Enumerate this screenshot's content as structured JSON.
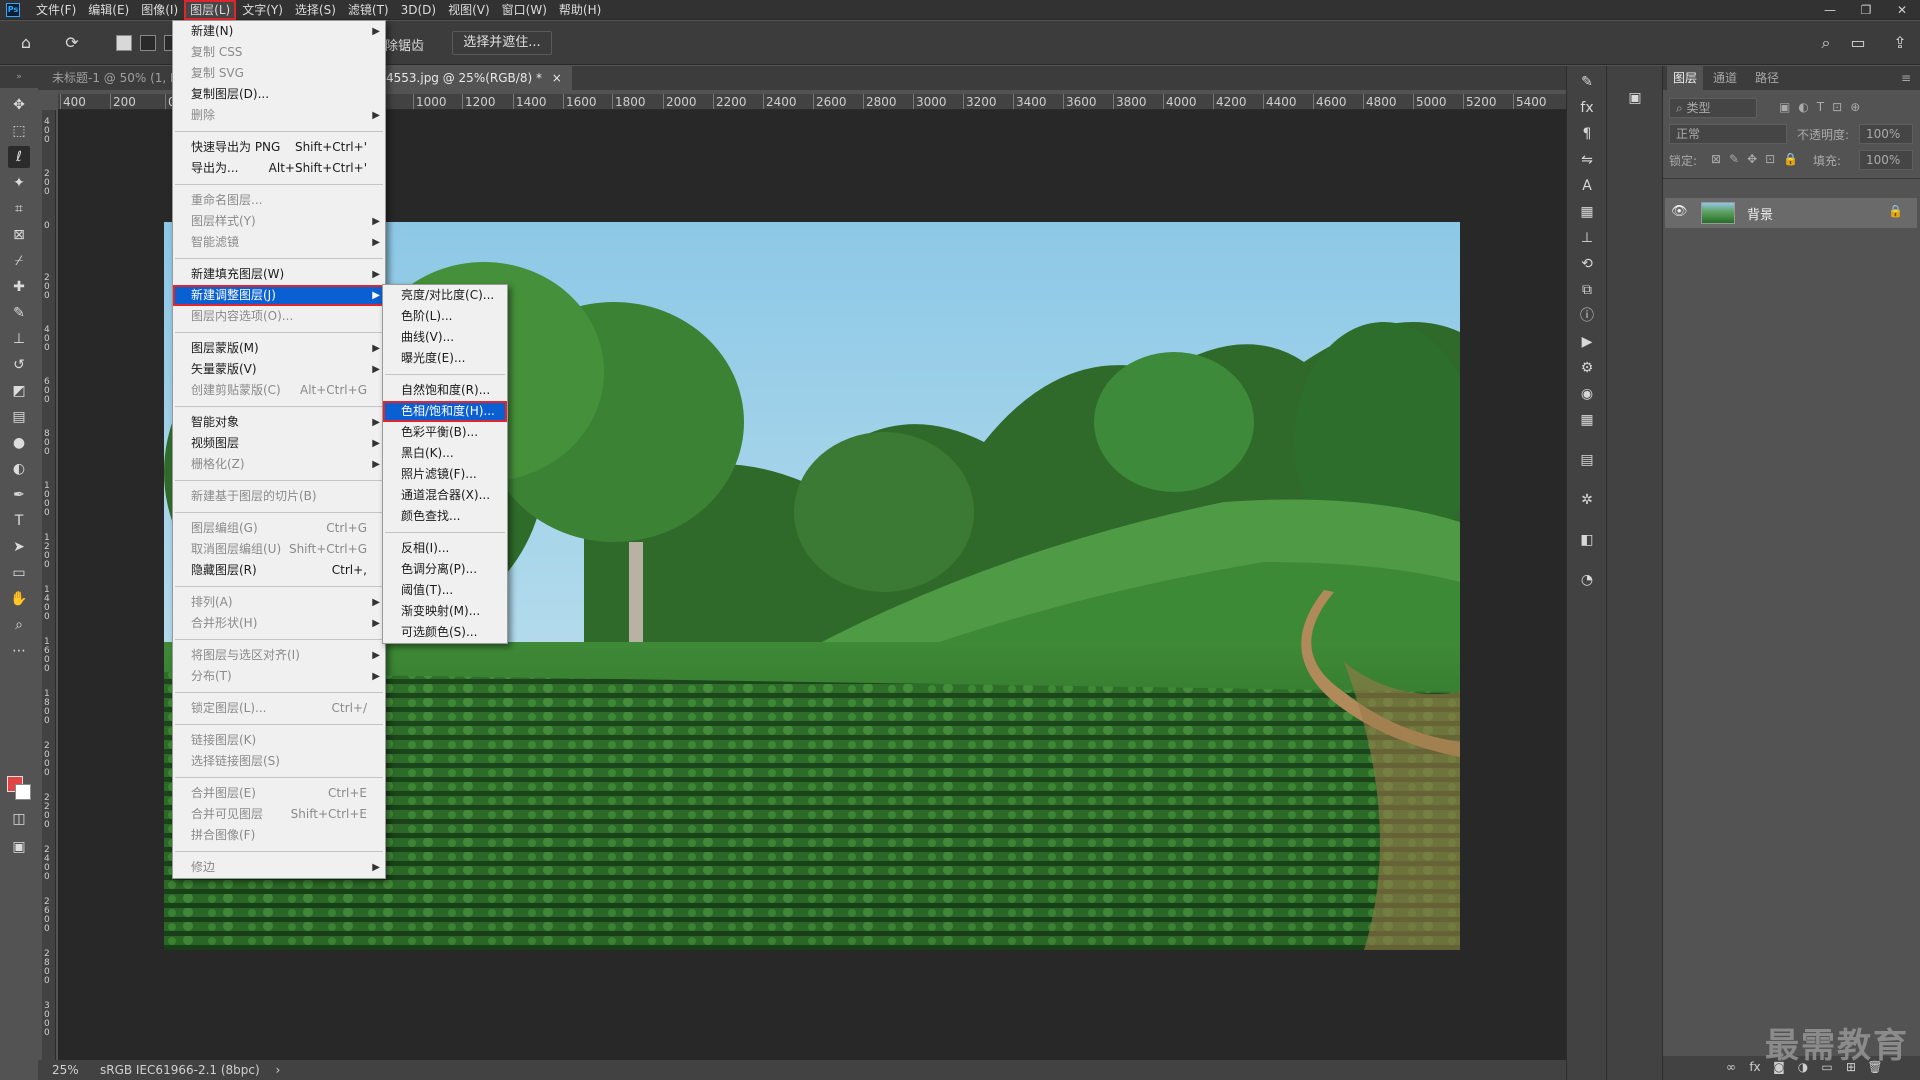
{
  "menubar": {
    "logo": "Ps",
    "items": [
      "文件(F)",
      "编辑(E)",
      "图像(I)",
      "图层(L)",
      "文字(Y)",
      "选择(S)",
      "滤镜(T)",
      "3D(D)",
      "视图(V)",
      "窗口(W)",
      "帮助(H)"
    ],
    "active_index": 3,
    "window_controls": [
      "—",
      "❐",
      "✕"
    ]
  },
  "options": {
    "antialias": "除锯齿",
    "select_mask": "选择并遮住..."
  },
  "tabs": [
    {
      "label": "未标题-1 @ 50% (1, R",
      "active": false
    },
    {
      "label": "4553.jpg @ 25%(RGB/8) *",
      "active": true
    },
    {
      "label": "×",
      "active": false
    }
  ],
  "ruler": {
    "h_labels": [
      "400",
      "200",
      "0",
      "1000",
      "1200",
      "1400",
      "1600",
      "1800",
      "2000",
      "2200",
      "2400",
      "2600",
      "2800",
      "3000",
      "3200",
      "3400",
      "3600",
      "3800",
      "4000",
      "4200",
      "4400",
      "4600",
      "4800",
      "5000",
      "5200",
      "5400"
    ],
    "v_labels": [
      "400",
      "200",
      "0",
      "200",
      "400",
      "600",
      "800",
      "1000",
      "1200",
      "1400",
      "1600",
      "1800",
      "2000",
      "2200",
      "2400",
      "2600",
      "2800",
      "3000"
    ]
  },
  "status": {
    "zoom": "25%",
    "profile": "sRGB IEC61966-2.1 (8bpc)",
    "arrow": "›"
  },
  "layers_panel": {
    "tabs": [
      "图层",
      "通道",
      "路径"
    ],
    "filter_placeholder": "类型",
    "blend_mode": "正常",
    "opacity_label": "不透明度:",
    "opacity_value": "100%",
    "lock_label": "锁定:",
    "fill_label": "填充:",
    "fill_value": "100%",
    "layer_name": "背景"
  },
  "watermark": "最需教育",
  "layer_menu": [
    {
      "label": "新建(N)",
      "arrow": true
    },
    {
      "label": "复制 CSS",
      "disabled": true
    },
    {
      "label": "复制 SVG",
      "disabled": true
    },
    {
      "label": "复制图层(D)..."
    },
    {
      "label": "删除",
      "arrow": true,
      "disabled": true
    },
    {
      "sep": true
    },
    {
      "label": "快速导出为 PNG",
      "shortcut": "Shift+Ctrl+'"
    },
    {
      "label": "导出为...",
      "shortcut": "Alt+Shift+Ctrl+'"
    },
    {
      "sep": true
    },
    {
      "label": "重命名图层...",
      "disabled": true
    },
    {
      "label": "图层样式(Y)",
      "arrow": true,
      "disabled": true
    },
    {
      "label": "智能滤镜",
      "arrow": true,
      "disabled": true
    },
    {
      "sep": true
    },
    {
      "label": "新建填充图层(W)",
      "arrow": true
    },
    {
      "label": "新建调整图层(J)",
      "arrow": true,
      "highlight": true
    },
    {
      "label": "图层内容选项(O)...",
      "disabled": true
    },
    {
      "sep": true
    },
    {
      "label": "图层蒙版(M)",
      "arrow": true
    },
    {
      "label": "矢量蒙版(V)",
      "arrow": true
    },
    {
      "label": "创建剪贴蒙版(C)",
      "shortcut": "Alt+Ctrl+G",
      "disabled": true
    },
    {
      "sep": true
    },
    {
      "label": "智能对象",
      "arrow": true
    },
    {
      "label": "视频图层",
      "arrow": true
    },
    {
      "label": "栅格化(Z)",
      "arrow": true,
      "disabled": true
    },
    {
      "sep": true
    },
    {
      "label": "新建基于图层的切片(B)",
      "disabled": true
    },
    {
      "sep": true
    },
    {
      "label": "图层编组(G)",
      "shortcut": "Ctrl+G",
      "disabled": true
    },
    {
      "label": "取消图层编组(U)",
      "shortcut": "Shift+Ctrl+G",
      "disabled": true
    },
    {
      "label": "隐藏图层(R)",
      "shortcut": "Ctrl+,"
    },
    {
      "sep": true
    },
    {
      "label": "排列(A)",
      "arrow": true,
      "disabled": true
    },
    {
      "label": "合并形状(H)",
      "arrow": true,
      "disabled": true
    },
    {
      "sep": true
    },
    {
      "label": "将图层与选区对齐(I)",
      "arrow": true,
      "disabled": true
    },
    {
      "label": "分布(T)",
      "arrow": true,
      "disabled": true
    },
    {
      "sep": true
    },
    {
      "label": "锁定图层(L)...",
      "shortcut": "Ctrl+/",
      "disabled": true
    },
    {
      "sep": true
    },
    {
      "label": "链接图层(K)",
      "disabled": true
    },
    {
      "label": "选择链接图层(S)",
      "disabled": true
    },
    {
      "sep": true
    },
    {
      "label": "合并图层(E)",
      "shortcut": "Ctrl+E",
      "disabled": true
    },
    {
      "label": "合并可见图层",
      "shortcut": "Shift+Ctrl+E",
      "disabled": true
    },
    {
      "label": "拼合图像(F)",
      "disabled": true
    },
    {
      "sep": true
    },
    {
      "label": "修边",
      "arrow": true,
      "disabled": true
    }
  ],
  "adjust_menu": [
    {
      "label": "亮度/对比度(C)..."
    },
    {
      "label": "色阶(L)..."
    },
    {
      "label": "曲线(V)..."
    },
    {
      "label": "曝光度(E)..."
    },
    {
      "sep": true
    },
    {
      "label": "自然饱和度(R)..."
    },
    {
      "label": "色相/饱和度(H)...",
      "highlight": true
    },
    {
      "label": "色彩平衡(B)..."
    },
    {
      "label": "黑白(K)..."
    },
    {
      "label": "照片滤镜(F)..."
    },
    {
      "label": "通道混合器(X)..."
    },
    {
      "label": "颜色查找..."
    },
    {
      "sep": true
    },
    {
      "label": "反相(I)..."
    },
    {
      "label": "色调分离(P)..."
    },
    {
      "label": "阈值(T)..."
    },
    {
      "label": "渐变映射(M)..."
    },
    {
      "label": "可选颜色(S)..."
    }
  ]
}
